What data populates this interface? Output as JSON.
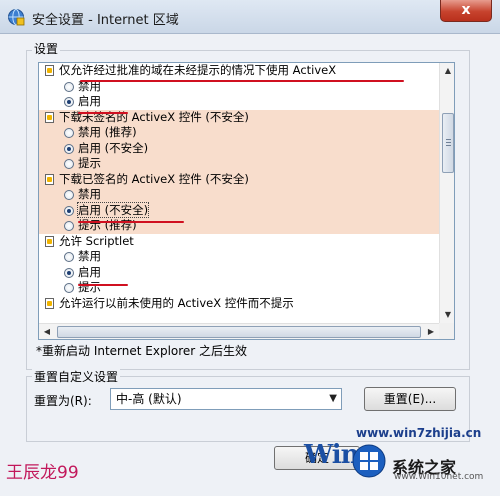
{
  "window": {
    "title": "安全设置 - Internet 区域",
    "close_label": "x"
  },
  "settings": {
    "group_label": "设置",
    "sections": [
      {
        "heading": "仅允许经过批准的域在未经提示的情况下使用 ActiveX",
        "shaded": false,
        "options": [
          {
            "label": "禁用",
            "checked": false
          },
          {
            "label": "启用",
            "checked": true
          }
        ]
      },
      {
        "heading": "下载未签名的 ActiveX 控件 (不安全)",
        "shaded": true,
        "options": [
          {
            "label": "禁用 (推荐)",
            "checked": false
          },
          {
            "label": "启用 (不安全)",
            "checked": true
          },
          {
            "label": "提示",
            "checked": false
          }
        ]
      },
      {
        "heading": "下载已签名的 ActiveX 控件 (不安全)",
        "shaded": true,
        "options": [
          {
            "label": "禁用",
            "checked": false
          },
          {
            "label": "启用 (不安全)",
            "checked": true
          },
          {
            "label": "提示 (推荐)",
            "checked": false
          }
        ]
      },
      {
        "heading": "允许 Scriptlet",
        "shaded": false,
        "options": [
          {
            "label": "禁用",
            "checked": false
          },
          {
            "label": "启用",
            "checked": true
          },
          {
            "label": "提示",
            "checked": false
          }
        ]
      },
      {
        "heading": "允许运行以前未使用的 ActiveX 控件而不提示",
        "shaded": false,
        "options": []
      }
    ],
    "restart_note": "*重新启动 Internet Explorer 之后生效"
  },
  "reset": {
    "group_label": "重置自定义设置",
    "reset_to_label": "重置为(R):",
    "selected_level": "中-高 (默认)",
    "reset_button": "重置(E)...",
    "ok_button": "确定"
  },
  "overlay": {
    "author_tag": "王辰龙99",
    "logo_domain": "www.win7zhijia.cn",
    "logo_win": "Win",
    "logo_cn": "系统之家",
    "logo_url": "www.Win10net.com"
  },
  "colors": {
    "shaded_row": "#f8ddcc",
    "annotation_red": "#d01020",
    "title_gradient_top": "#dfe8f3"
  }
}
